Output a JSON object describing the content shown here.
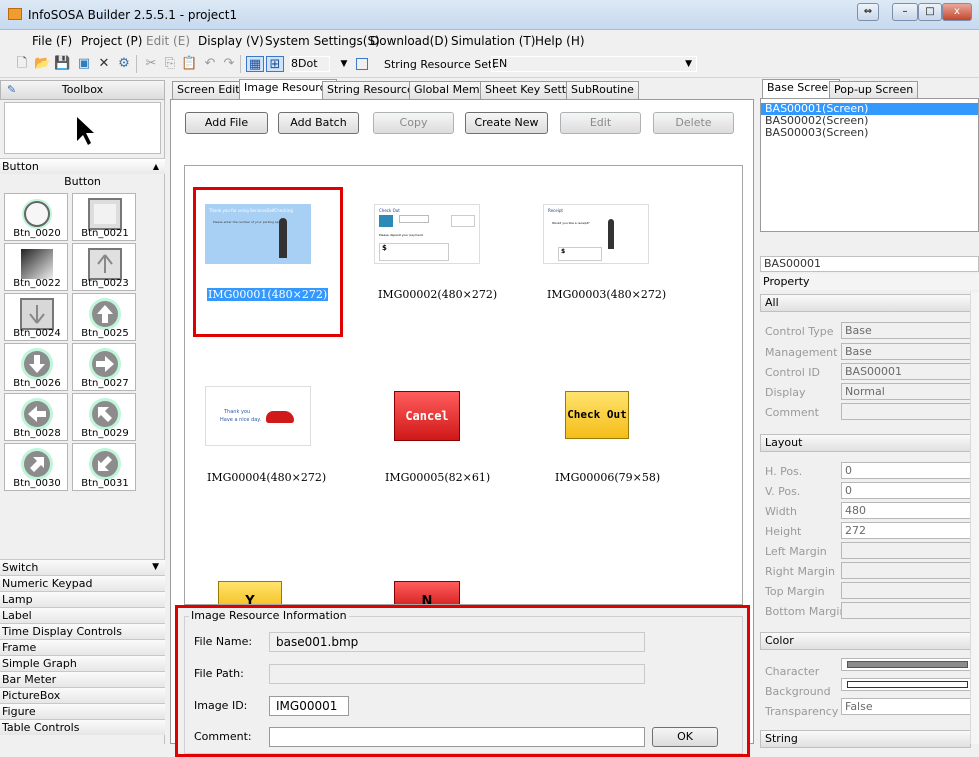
{
  "window": {
    "title": "InfoSOSA Builder 2.5.5.1 - project1",
    "min": "–",
    "max": "□",
    "close": "x",
    "restore": "⇔"
  },
  "menu": [
    "File (F)",
    "Project (P)",
    "Edit (E)",
    "Display (V)",
    "System Settings(S)",
    "Download(D)",
    "Simulation (T)",
    "Help (H)"
  ],
  "toolbar": {
    "grid_value": "8Dot",
    "string_set_label": "String Resource Set:",
    "string_set_value": "EN"
  },
  "toolbox": {
    "title": "Toolbox",
    "category_open": "Button",
    "subheader": "Button",
    "buttons": [
      "Btn_0020",
      "Btn_0021",
      "Btn_0022",
      "Btn_0023",
      "Btn_0024",
      "Btn_0025",
      "Btn_0026",
      "Btn_0027",
      "Btn_0028",
      "Btn_0029",
      "Btn_0030",
      "Btn_0031"
    ],
    "categories": [
      "Switch",
      "Numeric Keypad",
      "Lamp",
      "Label",
      "Time Display Controls",
      "Frame",
      "Simple Graph",
      "Bar Meter",
      "PictureBox",
      "Figure",
      "Table Controls"
    ]
  },
  "tabs": [
    "Screen Editor",
    "Image Resource",
    "String Resources",
    "Global Memory",
    "Sheet Key Setting",
    "SubRoutine"
  ],
  "actions": {
    "add_file": "Add File",
    "add_batch": "Add Batch",
    "copy": "Copy",
    "create_new": "Create New",
    "edit": "Edit",
    "delete": "Delete"
  },
  "images": [
    {
      "caption": "IMG00001(480×272)"
    },
    {
      "caption": "IMG00002(480×272)"
    },
    {
      "caption": "IMG00003(480×272)"
    },
    {
      "caption": "IMG00004(480×272)"
    },
    {
      "caption": "IMG00005(82×61)"
    },
    {
      "caption": "IMG00006(79×58)"
    }
  ],
  "thumb_text": {
    "t1_head": "Thank you for using ServicesSelfChecking",
    "t1_sub": "Please enter the number of your parking space",
    "t2_head": "Check Out",
    "t2_mid": "Please deposit your payment",
    "t2_dollar": "$",
    "t3_head": "Receipt",
    "t3_sub": "Would you like a receipt?",
    "t3_dollar": "$",
    "t4_line1": "Thank you",
    "t4_line2": "Have a nice day.",
    "cancel": "Cancel",
    "checkout": "Check Out",
    "partial_y": "Y",
    "partial_n": "N"
  },
  "info": {
    "legend": "Image Resource Information",
    "file_name_label": "File Name:",
    "file_name": "base001.bmp",
    "file_path_label": "File Path:",
    "file_path": "",
    "image_id_label": "Image ID:",
    "image_id": "IMG00001",
    "comment_label": "Comment:",
    "comment": "",
    "ok": "OK"
  },
  "right": {
    "tabs": [
      "Base Screen",
      "Pop-up Screen"
    ],
    "screens": [
      "BAS00001(Screen)",
      "BAS00002(Screen)",
      "BAS00003(Screen)"
    ],
    "prop_title": "BAS00001",
    "prop_sub": "Property",
    "sections": [
      "All",
      "Layout",
      "Color",
      "String"
    ],
    "all_props": [
      {
        "k": "Control Type",
        "v": "Base"
      },
      {
        "k": "Management ID",
        "v": "Base"
      },
      {
        "k": "Control ID",
        "v": "BAS00001"
      },
      {
        "k": "Display",
        "v": "Normal"
      },
      {
        "k": "Comment",
        "v": ""
      }
    ],
    "layout_props": [
      {
        "k": "H. Pos.",
        "v": "0"
      },
      {
        "k": "V. Pos.",
        "v": "0"
      },
      {
        "k": "Width",
        "v": "480"
      },
      {
        "k": "Height",
        "v": "272"
      },
      {
        "k": "Left Margin",
        "v": ""
      },
      {
        "k": "Right Margin",
        "v": ""
      },
      {
        "k": "Top Margin",
        "v": ""
      },
      {
        "k": "Bottom Margin",
        "v": ""
      }
    ],
    "color_props": [
      {
        "k": "Character",
        "v": ""
      },
      {
        "k": "Background",
        "v": ""
      },
      {
        "k": "Transparency",
        "v": "False"
      }
    ]
  }
}
